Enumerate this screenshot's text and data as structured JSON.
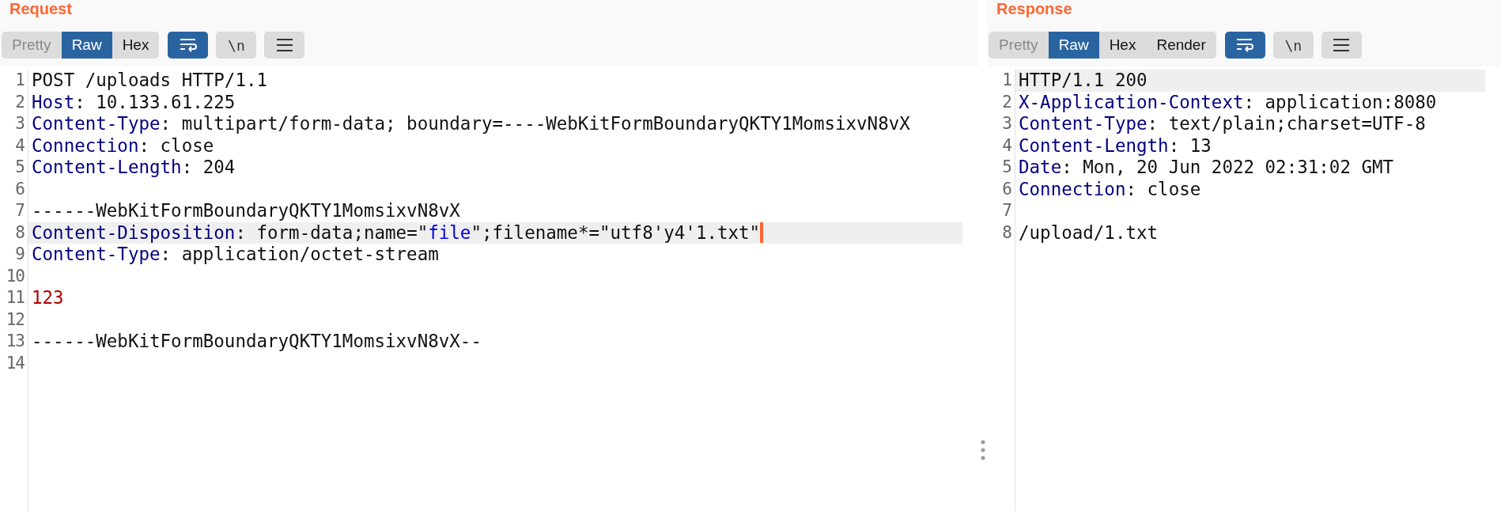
{
  "panes": [
    {
      "title": "Request",
      "view_tabs": [
        {
          "label": "Pretty",
          "selected": false,
          "disabled": true
        },
        {
          "label": "Raw",
          "selected": true,
          "disabled": false
        },
        {
          "label": "Hex",
          "selected": false,
          "disabled": false
        }
      ],
      "tools": [
        {
          "kind": "wrap",
          "on": true
        },
        {
          "kind": "newline",
          "label": "\\n",
          "on": false
        },
        {
          "kind": "menu",
          "on": false
        }
      ],
      "lines": [
        {
          "number": "1",
          "selected": false,
          "caret": false,
          "tokens": [
            {
              "kind": "plain",
              "text": "POST /uploads HTTP/1.1"
            }
          ]
        },
        {
          "number": "2",
          "selected": false,
          "caret": false,
          "tokens": [
            {
              "kind": "key",
              "text": "Host"
            },
            {
              "kind": "plain",
              "text": ": 10.133.61.225"
            }
          ]
        },
        {
          "number": "3",
          "selected": false,
          "caret": false,
          "tokens": [
            {
              "kind": "key",
              "text": "Content-Type"
            },
            {
              "kind": "plain",
              "text": ": multipart/form-data; boundary=----WebKitFormBoundaryQKTY1MomsixvN8vX"
            }
          ]
        },
        {
          "number": "4",
          "selected": false,
          "caret": false,
          "tokens": [
            {
              "kind": "key",
              "text": "Connection"
            },
            {
              "kind": "plain",
              "text": ": close"
            }
          ]
        },
        {
          "number": "5",
          "selected": false,
          "caret": false,
          "tokens": [
            {
              "kind": "key",
              "text": "Content-Length"
            },
            {
              "kind": "plain",
              "text": ": 204"
            }
          ]
        },
        {
          "number": "6",
          "selected": false,
          "caret": false
        },
        {
          "number": "7",
          "selected": false,
          "caret": false,
          "tokens": [
            {
              "kind": "plain",
              "text": "------WebKitFormBoundaryQKTY1MomsixvN8vX"
            }
          ]
        },
        {
          "number": "8",
          "selected": true,
          "caret": true,
          "tokens": [
            {
              "kind": "key",
              "text": "Content-Disposition"
            },
            {
              "kind": "plain",
              "text": ": form-data;name=\""
            },
            {
              "kind": "string",
              "text": "file"
            },
            {
              "kind": "plain",
              "text": "\";filename*=\"utf8'y4'1.txt\""
            }
          ]
        },
        {
          "number": "9",
          "selected": false,
          "caret": false,
          "tokens": [
            {
              "kind": "key",
              "text": "Content-Type"
            },
            {
              "kind": "plain",
              "text": ": application/octet-stream"
            }
          ]
        },
        {
          "number": "10",
          "selected": false,
          "caret": false
        },
        {
          "number": "11",
          "selected": false,
          "caret": false,
          "tokens": [
            {
              "kind": "number",
              "text": "123"
            }
          ]
        },
        {
          "number": "12",
          "selected": false,
          "caret": false
        },
        {
          "number": "13",
          "selected": false,
          "caret": false,
          "tokens": [
            {
              "kind": "plain",
              "text": "------WebKitFormBoundaryQKTY1MomsixvN8vX--"
            }
          ]
        },
        {
          "number": "14",
          "selected": false,
          "caret": false
        }
      ]
    },
    {
      "title": "Response",
      "view_tabs": [
        {
          "label": "Pretty",
          "selected": false,
          "disabled": true
        },
        {
          "label": "Raw",
          "selected": true,
          "disabled": false
        },
        {
          "label": "Hex",
          "selected": false,
          "disabled": false
        },
        {
          "label": "Render",
          "selected": false,
          "disabled": false
        }
      ],
      "tools": [
        {
          "kind": "wrap",
          "on": true
        },
        {
          "kind": "newline",
          "label": "\\n",
          "on": false
        },
        {
          "kind": "menu",
          "on": false
        }
      ],
      "lines": [
        {
          "number": "1",
          "selected": true,
          "caret": false,
          "tokens": [
            {
              "kind": "plain",
              "text": "HTTP/1.1 200"
            }
          ]
        },
        {
          "number": "2",
          "selected": false,
          "caret": false,
          "tokens": [
            {
              "kind": "key",
              "text": "X-Application-Context"
            },
            {
              "kind": "plain",
              "text": ": application:8080"
            }
          ]
        },
        {
          "number": "3",
          "selected": false,
          "caret": false,
          "tokens": [
            {
              "kind": "key",
              "text": "Content-Type"
            },
            {
              "kind": "plain",
              "text": ": text/plain;charset=UTF-8"
            }
          ]
        },
        {
          "number": "4",
          "selected": false,
          "caret": false,
          "tokens": [
            {
              "kind": "key",
              "text": "Content-Length"
            },
            {
              "kind": "plain",
              "text": ": 13"
            }
          ]
        },
        {
          "number": "5",
          "selected": false,
          "caret": false,
          "tokens": [
            {
              "kind": "key",
              "text": "Date"
            },
            {
              "kind": "plain",
              "text": ": Mon, 20 Jun 2022 02:31:02 GMT"
            }
          ]
        },
        {
          "number": "6",
          "selected": false,
          "caret": false,
          "tokens": [
            {
              "kind": "key",
              "text": "Connection"
            },
            {
              "kind": "plain",
              "text": ": close"
            }
          ]
        },
        {
          "number": "7",
          "selected": false,
          "caret": false
        },
        {
          "number": "8",
          "selected": false,
          "caret": false,
          "tokens": [
            {
              "kind": "plain",
              "text": "/upload/1.txt"
            }
          ]
        }
      ]
    }
  ]
}
